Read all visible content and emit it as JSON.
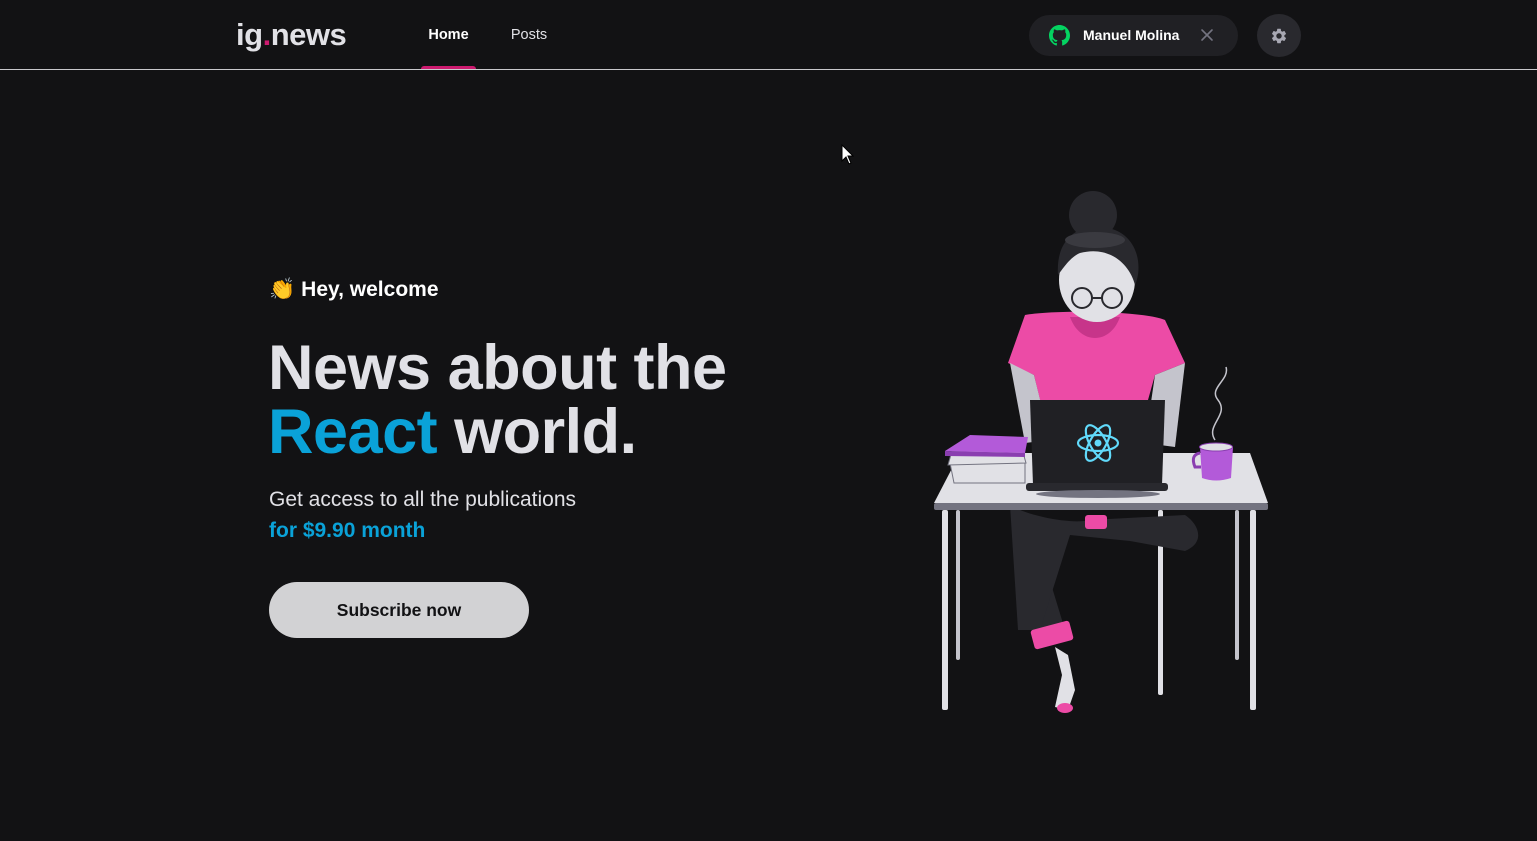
{
  "header": {
    "logo_main": "ig",
    "logo_dot": ".",
    "logo_rest": "news",
    "nav": [
      {
        "label": "Home",
        "active": true
      },
      {
        "label": "Posts",
        "active": false
      }
    ],
    "user_name": "Manuel Molina",
    "icons": [
      "github-icon",
      "close-icon",
      "gear-icon"
    ]
  },
  "hero": {
    "greeting": "Hey, welcome",
    "greeting_emoji": "👏",
    "headline_line1": "News about the",
    "headline_accent": "React",
    "headline_rest": " world.",
    "access_text": "Get access to all the publications",
    "price_text": "for $9.90 month",
    "subscribe_label": "Subscribe now"
  },
  "colors": {
    "background": "#121214",
    "accent_pink": "#cc1a6f",
    "accent_blue": "#0aa2d8",
    "github_green": "#04d361"
  }
}
